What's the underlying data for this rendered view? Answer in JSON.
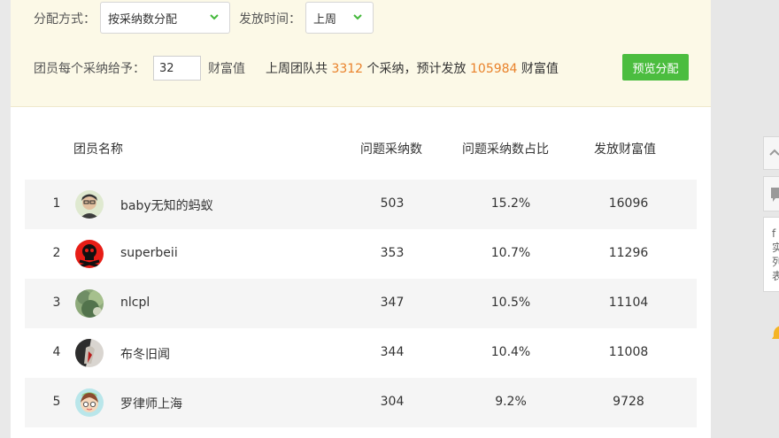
{
  "config": {
    "mode_label": "分配方式：",
    "mode_value": "按采纳数分配",
    "time_label": "发放时间：",
    "time_value": "上周",
    "per_adoption_label": "团员每个采纳给予：",
    "per_adoption_value": "32",
    "per_adoption_unit": "财富值",
    "summary": {
      "prefix": "上周团队共",
      "adoptions": "3312",
      "middle": "个采纳，预计发放",
      "wealth": "105984",
      "suffix": "财富值"
    },
    "preview_button": "预览分配"
  },
  "table": {
    "headers": {
      "name": "团员名称",
      "adoptions": "问题采纳数",
      "share": "问题采纳数占比",
      "wealth": "发放财富值"
    },
    "rows": [
      {
        "rank": "1",
        "name": "baby无知的蚂蚁",
        "adoptions": "503",
        "share": "15.2%",
        "wealth": "16096",
        "avatar": "person-photo-avatar"
      },
      {
        "rank": "2",
        "name": "superbeii",
        "adoptions": "353",
        "share": "10.7%",
        "wealth": "11296",
        "avatar": "skull-avatar"
      },
      {
        "rank": "3",
        "name": "nlcpl",
        "adoptions": "347",
        "share": "10.5%",
        "wealth": "11104",
        "avatar": "nature-photo-avatar"
      },
      {
        "rank": "4",
        "name": "布冬旧闻",
        "adoptions": "344",
        "share": "10.4%",
        "wealth": "11008",
        "avatar": "dark-figure-avatar"
      },
      {
        "rank": "5",
        "name": "罗律师上海",
        "adoptions": "304",
        "share": "9.2%",
        "wealth": "9728",
        "avatar": "cartoon-girl-avatar"
      }
    ]
  },
  "side": {
    "partial_text": [
      "f",
      "实",
      "列",
      "表"
    ]
  },
  "colors": {
    "highlight_number": "#e9822b",
    "button_green": "#4bbd3f",
    "config_background": "#fcf9e7",
    "row_background": "#f5f5f5"
  }
}
